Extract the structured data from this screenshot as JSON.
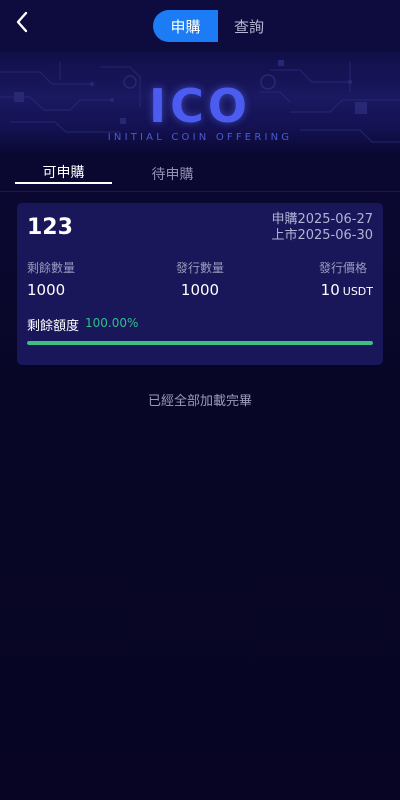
{
  "header": {
    "segments": [
      {
        "label": "申購",
        "active": true
      },
      {
        "label": "查詢",
        "active": false
      }
    ]
  },
  "banner": {
    "title": "ICO",
    "subtitle": "INITIAL COIN OFFERING"
  },
  "tabs": [
    {
      "label": "可申購",
      "active": true
    },
    {
      "label": "待申購",
      "active": false
    }
  ],
  "card": {
    "name": "123",
    "subscribe_date": "申購2025-06-27",
    "listing_date": "上市2025-06-30",
    "stats": {
      "remaining_label": "剩餘數量",
      "remaining_value": "1000",
      "issued_label": "發行數量",
      "issued_value": "1000",
      "price_label": "發行價格",
      "price_value": "10",
      "price_unit": "USDT"
    },
    "remaining_quota_label": "剩餘額度",
    "remaining_quota_percent": "100.00%",
    "progress": 1.0
  },
  "list_end_text": "已經全部加載完畢",
  "colors": {
    "accent": "#1b7cf5",
    "progress": "#3dbf86",
    "percent_text": "#2fbf8a",
    "card_bg": "#19165a",
    "page_bg": "#080626"
  },
  "icons": {
    "back": "chevron-left-icon"
  }
}
